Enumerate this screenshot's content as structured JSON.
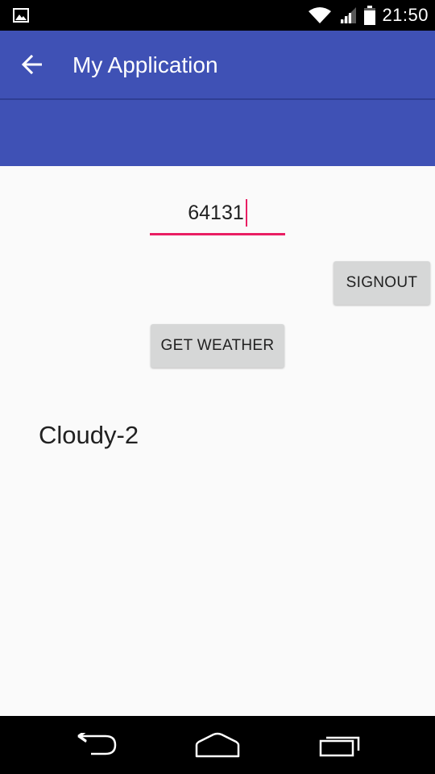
{
  "status_bar": {
    "time": "21:50",
    "icons": [
      "gallery-notification-icon",
      "wifi-icon",
      "cell-signal-icon",
      "battery-icon"
    ]
  },
  "app_bar": {
    "title": "My Application",
    "back_icon": "arrow-back-icon",
    "color": "#3f51b5"
  },
  "form": {
    "zip_value": "64131",
    "accent_color": "#e91e63"
  },
  "buttons": {
    "signout_label": "SIGNOUT",
    "get_weather_label": "GET WEATHER"
  },
  "result": {
    "text": "Cloudy-2"
  },
  "nav_bar": {
    "icons": [
      "back-icon",
      "home-icon",
      "recents-icon"
    ]
  }
}
